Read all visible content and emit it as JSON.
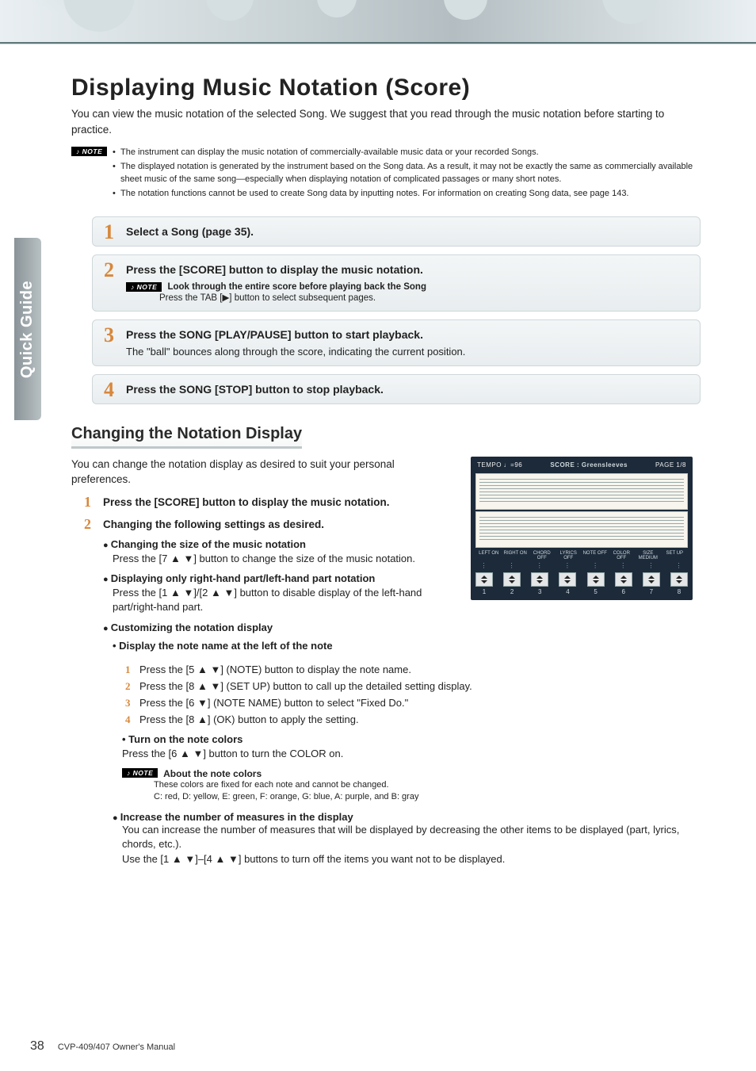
{
  "side_tab": "Quick Guide",
  "title": "Displaying Music Notation (Score)",
  "intro": "You can view the music notation of the selected Song. We suggest that you read through the music notation before starting to practice.",
  "top_note_flag": "NOTE",
  "top_notes": [
    "The instrument can display the music notation of commercially-available music data or your recorded Songs.",
    "The displayed notation is generated by the instrument based on the Song data. As a result, it may not be exactly the same as commercially available sheet music of the same song—especially when displaying notation of complicated passages or many short notes.",
    "The notation functions cannot be used to create Song data by inputting notes. For information on creating Song data, see page 143."
  ],
  "steps": [
    {
      "n": "1",
      "title": "Select a Song (page 35)."
    },
    {
      "n": "2",
      "title": "Press the [SCORE] button to display the music notation.",
      "note_flag": "NOTE",
      "note_bold": "Look through the entire score before playing back the Song",
      "note_body": "Press the TAB [▶] button to select subsequent pages."
    },
    {
      "n": "3",
      "title": "Press the SONG [PLAY/PAUSE] button to start playback.",
      "sub": "The \"ball\" bounces along through the score, indicating the current position."
    },
    {
      "n": "4",
      "title": "Press the SONG [STOP] button to stop playback."
    }
  ],
  "section2_heading": "Changing the Notation Display",
  "section2_intro": "You can change the notation display as desired to suit your personal preferences.",
  "change_steps": [
    {
      "n": "1",
      "t": "Press the [SCORE] button to display the music notation."
    },
    {
      "n": "2",
      "t": "Changing the following settings as desired."
    }
  ],
  "bullets": {
    "size_title": "Changing the size of the music notation",
    "size_body": "Press the [7 ▲ ▼] button to change the size of the music notation.",
    "lr_title": "Displaying only right-hand part/left-hand part notation",
    "lr_body": "Press the [1 ▲ ▼]/[2 ▲ ▼] button to disable display of the left-hand part/right-hand part.",
    "custom_title": "Customizing the notation display",
    "note_name_title": "Display the note name at the left of the note",
    "note_name_steps": [
      "Press the [5 ▲ ▼] (NOTE) button to display the note name.",
      "Press the [8 ▲ ▼] (SET UP) button to call up the detailed setting display.",
      "Press the [6 ▼] (NOTE NAME) button to select \"Fixed Do.\"",
      "Press the [8 ▲] (OK) button to apply the setting."
    ],
    "colors_title": "Turn on the note colors",
    "colors_body": "Press the [6 ▲ ▼] button to turn the COLOR on.",
    "about_flag": "NOTE",
    "about_title": "About the note colors",
    "about_l1": "These colors are fixed for each note and cannot be changed.",
    "about_l2": "C: red, D: yellow, E: green, F: orange, G: blue, A: purple, and B: gray",
    "measures_title": "Increase the number of measures in the display",
    "measures_l1": "You can increase the number of measures that will be displayed by decreasing the other items to be displayed (part, lyrics, chords, etc.).",
    "measures_l2": "Use the [1 ▲ ▼]–[4 ▲ ▼] buttons to turn off the items you want not to be displayed."
  },
  "chart_data": {
    "type": "table",
    "title": "SCORE : Greensleeves",
    "tempo_text": "TEMPO ♩=96",
    "page_text": "PAGE 1/8",
    "button_labels": [
      "LEFT ON",
      "RIGHT ON",
      "CHORD OFF",
      "LYRICS OFF",
      "NOTE OFF",
      "COLOR OFF",
      "SIZE MEDIUM",
      "SET UP"
    ],
    "button_numbers": [
      "1",
      "2",
      "3",
      "4",
      "5",
      "6",
      "7",
      "8"
    ]
  },
  "footer": {
    "page": "38",
    "text": "CVP-409/407 Owner's Manual"
  }
}
